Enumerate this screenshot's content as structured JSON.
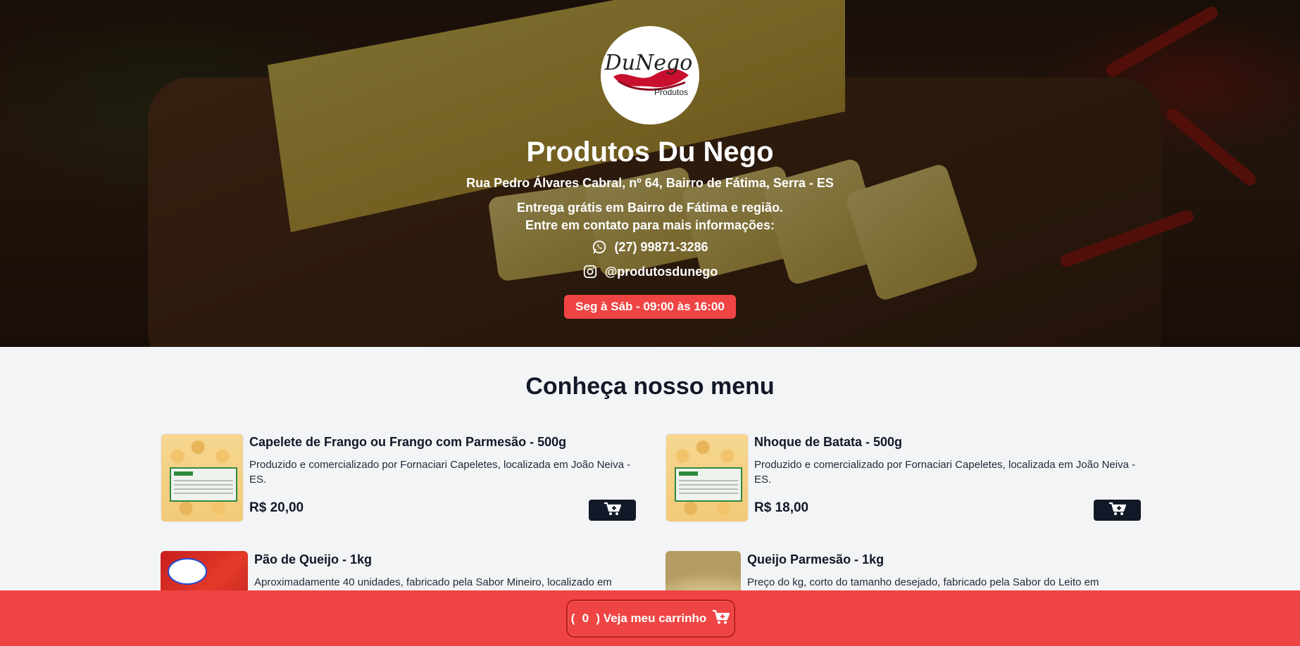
{
  "store": {
    "logo_text": "DuNego",
    "logo_subtext": "Produtos",
    "name": "Produtos Du Nego",
    "address": "Rua Pedro Álvares Cabral, nº 64, Bairro de Fátima, Serra - ES",
    "delivery_info": "Entrega grátis em Bairro de Fátima e região.",
    "contact_info": "Entre em contato para mais informações:",
    "phone": "(27) 99871-3286",
    "instagram": "@produtosdunego",
    "hours": "Seg à Sáb - 09:00 às 16:00"
  },
  "menu": {
    "title": "Conheça nosso menu",
    "products": [
      {
        "name": "Capelete de Frango ou Frango com Parmesão - 500g",
        "description": "Produzido e comercializado por Fornaciari Capeletes, localizada em João Neiva - ES.",
        "price": "R$ 20,00",
        "image_label": "FORNACIARI"
      },
      {
        "name": "Nhoque de Batata - 500g",
        "description": "Produzido e comercializado por Fornaciari Capeletes, localizada em João Neiva - ES.",
        "price": "R$ 18,00",
        "image_label": "FORNACIARI"
      },
      {
        "name": "Pão de Queijo - 1kg",
        "description": "Aproximadamente 40 unidades, fabricado pela Sabor Mineiro, localizado em",
        "image_label": "Sabor Mineiro"
      },
      {
        "name": "Queijo Parmesão - 1kg",
        "description": "Preço do kg, corto do tamanho desejado, fabricado pela Sabor do Leito em"
      }
    ]
  },
  "cart": {
    "open_paren": "(",
    "count": "0",
    "label": ") Veja meu carrinho"
  },
  "colors": {
    "accent": "#ef4444",
    "dark_button": "#111827",
    "page_bg": "#f3f4f6"
  },
  "icons": {
    "phone": "whatsapp-icon",
    "instagram": "instagram-icon",
    "add_to_cart": "cart-plus-icon",
    "cart": "cart-icon"
  }
}
